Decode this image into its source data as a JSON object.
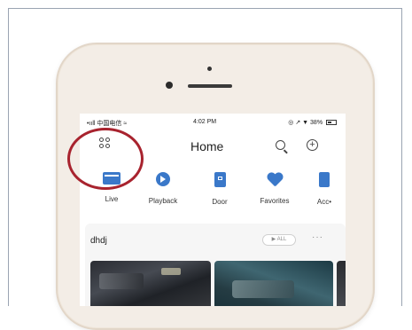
{
  "status_bar": {
    "carrier": "•ııll 中国电信 ≈",
    "time": "4:02 PM",
    "right": "◎ ↗ ▼ 38%"
  },
  "header": {
    "title": "Home"
  },
  "icons": {
    "apps": "apps-grid-icon",
    "search": "search-icon",
    "add": "add-circle-icon"
  },
  "nav": {
    "items": [
      {
        "label": "Live",
        "icon": "live-icon"
      },
      {
        "label": "Playback",
        "icon": "playback-icon"
      },
      {
        "label": "Door",
        "icon": "door-icon"
      },
      {
        "label": "Favorites",
        "icon": "heart-icon"
      },
      {
        "label": "Acc•",
        "icon": "accessory-icon"
      }
    ]
  },
  "section": {
    "name": "dhdj",
    "all_label": "▶ ALL",
    "more": "···"
  },
  "colors": {
    "accent": "#3a78c9",
    "highlight_circle": "#a8232e",
    "phone_body": "#f3ede6"
  }
}
